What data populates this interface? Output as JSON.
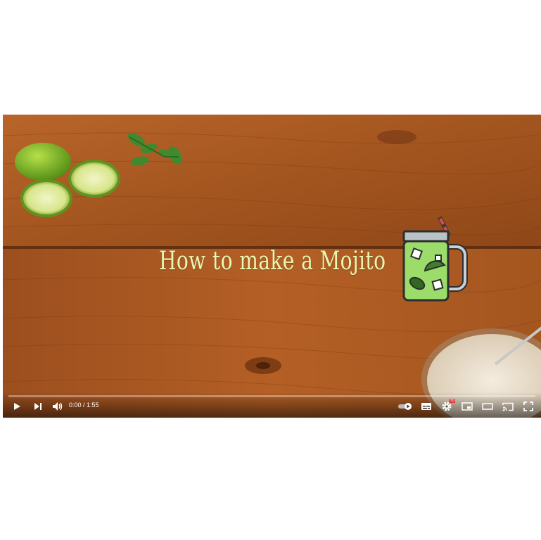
{
  "video": {
    "title_overlay": "How to make a Mojito",
    "time_current": "0:00",
    "time_separator": " / ",
    "time_total": "1:55",
    "progress": 0,
    "settings_badge": "HD"
  },
  "icons": [
    "play-icon",
    "next-icon",
    "volume-icon",
    "autoplay-toggle-icon",
    "subtitles-icon",
    "settings-icon",
    "miniplayer-icon",
    "theater-icon",
    "cast-icon",
    "fullscreen-icon"
  ],
  "colors": {
    "wood": "#a2561f",
    "title": "#e7f7b4",
    "jar_green": "#9bdc6a"
  }
}
